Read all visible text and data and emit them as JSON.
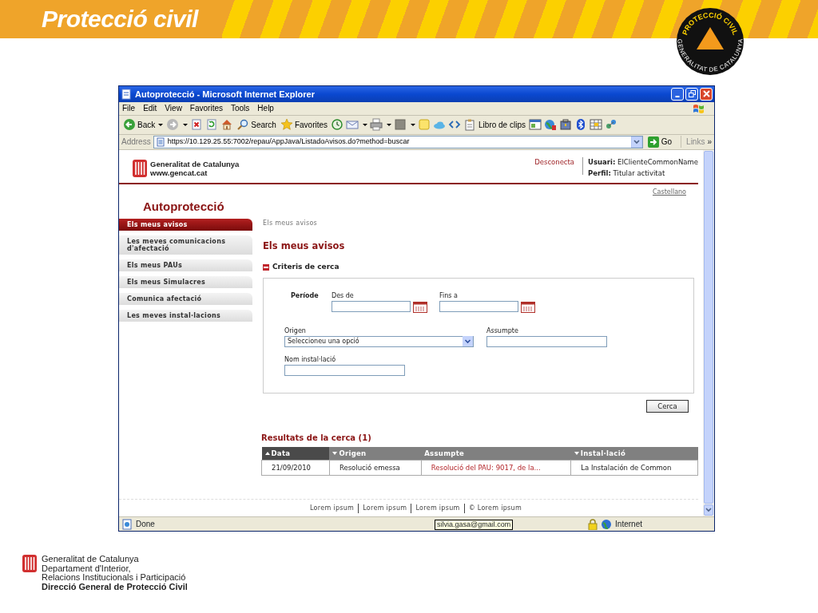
{
  "banner": {
    "title": "Protecció civil",
    "badge": {
      "top_text": "PROTECCIÓ CIVIL",
      "bottom_text": "GENERALITAT DE CATALUNYA"
    }
  },
  "window": {
    "title": "Autoprotecció - Microsoft Internet Explorer",
    "menu": [
      "File",
      "Edit",
      "View",
      "Favorites",
      "Tools",
      "Help"
    ],
    "toolbar": [
      {
        "kind": "back",
        "label": "Back",
        "dropdown": true
      },
      {
        "kind": "forward",
        "dropdown": true
      },
      {
        "kind": "stop"
      },
      {
        "kind": "refresh"
      },
      {
        "kind": "home"
      },
      {
        "kind": "search",
        "label": "Search"
      },
      {
        "kind": "favorites",
        "label": "Favorites"
      },
      {
        "kind": "history"
      },
      {
        "kind": "mail",
        "dropdown": true
      },
      {
        "kind": "print",
        "dropdown": true
      },
      {
        "kind": "edit",
        "dropdown": true
      },
      {
        "kind": "note"
      },
      {
        "kind": "cloud"
      },
      {
        "kind": "code"
      },
      {
        "kind": "clips",
        "label": "Libro de clips"
      },
      {
        "kind": "window"
      },
      {
        "kind": "globe"
      },
      {
        "kind": "tools"
      },
      {
        "kind": "bluetooth"
      },
      {
        "kind": "grid"
      },
      {
        "kind": "network"
      }
    ],
    "address": {
      "label": "Address",
      "url": "https://10.129.25.55:7002/repau/AppJava/ListadoAvisos.do?method=buscar",
      "go": "Go",
      "links": "Links",
      "more": "»"
    },
    "page": {
      "org": [
        "Generalitat de Catalunya",
        "www.gencat.cat"
      ],
      "logout": "Desconecta",
      "user": [
        "**Usuari:** ElClienteCommonName",
        "**Perfil:** Titular activitat"
      ],
      "language": "Castellano",
      "app_title": "Autoprotecció",
      "sidebar": [
        {
          "label": "Els meus avisos",
          "selected": true
        },
        {
          "label": "Les meves comunicacions d'afectació",
          "selected": false
        },
        {
          "label": "Els meus PAUs",
          "selected": false
        },
        {
          "label": "Els meus Simulacres",
          "selected": false
        },
        {
          "label": "Comunica afectació",
          "selected": false
        },
        {
          "label": "Les meves instal·lacions",
          "selected": false
        }
      ],
      "breadcrumb": "Els meus avisos",
      "heading": "Els meus avisos",
      "criteria": {
        "title": "Criteris de cerca",
        "expanded": true,
        "period_label": "Període",
        "from_label": "Des de",
        "to_label": "Fins a",
        "origin_label": "Origen",
        "origin_value": "Seleccioneu una opció",
        "subject_label": "Assumpte",
        "name_label": "Nom instal·lació"
      },
      "search_button": "Cerca",
      "results": {
        "title": "Resultats de la cerca (1)",
        "columns": [
          {
            "label": "Data",
            "sortable": true,
            "ascending": true,
            "active": true
          },
          {
            "label": "Origen",
            "sortable": true,
            "ascending": false,
            "active": false
          },
          {
            "label": "Assumpte",
            "sortable": false,
            "active": false
          },
          {
            "label": "Instal·lació",
            "sortable": true,
            "ascending": false,
            "active": false
          }
        ],
        "rows": [
          {
            "cells": [
              {
                "kind": "text",
                "text": "21/09/2010"
              },
              {
                "kind": "text",
                "text": "Resolució emessa"
              },
              {
                "kind": "link",
                "text": "Resolució del PAU: 9017, de la..."
              },
              {
                "kind": "text",
                "text": "La Instalación de Common"
              }
            ]
          }
        ]
      },
      "footer_links": [
        "Lorem ipsum",
        "Lorem ipsum",
        "Lorem ipsum",
        "© Lorem ipsum"
      ]
    },
    "status_bar": {
      "text": "Done",
      "tooltip": "silvia.gasa@gmail.com",
      "zone": "Internet"
    }
  },
  "footer_logo": {
    "lines": [
      "Generalitat de Catalunya",
      "Departament d'Interior,",
      "Relacions Institucionals i Participació",
      "Direcció General de Protecció Civil"
    ]
  }
}
